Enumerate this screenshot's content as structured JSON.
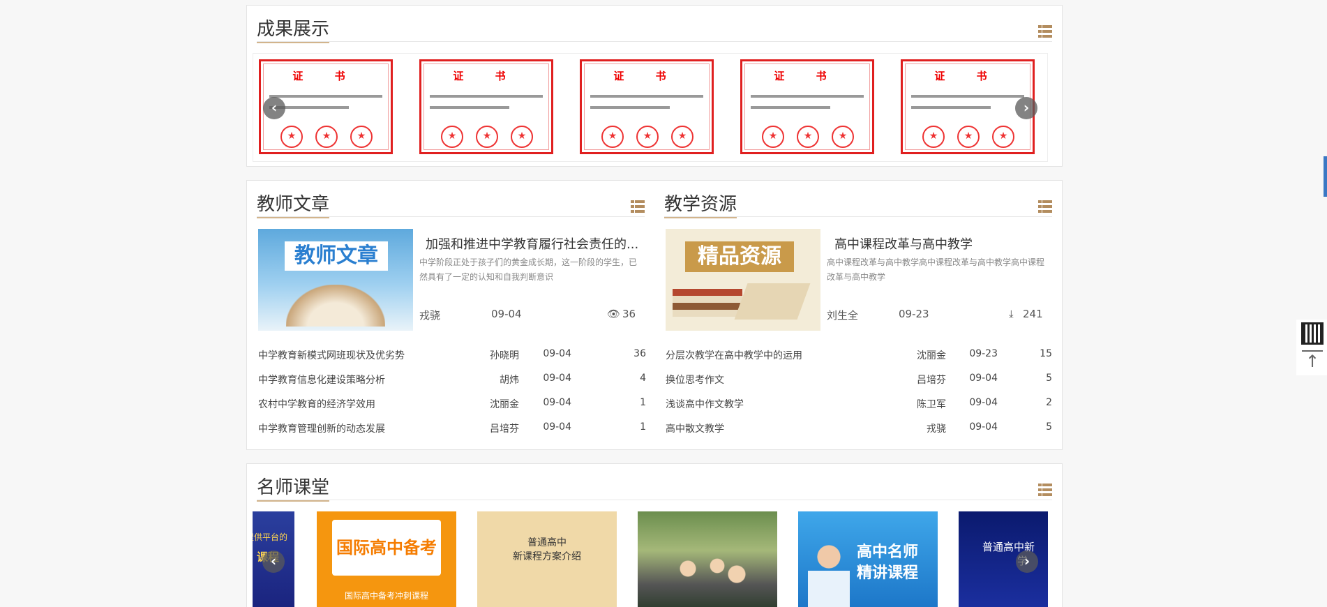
{
  "achievements": {
    "title": "成果展示",
    "cert_title": "证 书",
    "items": [
      "cert-1",
      "cert-2",
      "cert-3",
      "cert-4",
      "cert-5"
    ],
    "prev_icon": "chevron-left-icon",
    "next_icon": "chevron-right-icon"
  },
  "articles": {
    "title": "教师文章",
    "featured": {
      "image_text": "教师文章",
      "title": "加强和推进中学教育履行社会责任的...",
      "desc": "中学阶段正处于孩子们的黄金成长期，这一阶段的学生，已然具有了一定的认知和自我判断意识",
      "author": "戎骁",
      "date": "09-04",
      "views": "36"
    },
    "list": [
      {
        "title": "中学教育新模式网班现状及优劣势",
        "author": "孙晓明",
        "date": "09-04",
        "count": "36"
      },
      {
        "title": "中学教育信息化建设策略分析",
        "author": "胡炜",
        "date": "09-04",
        "count": "4"
      },
      {
        "title": "农村中学教育的经济学效用",
        "author": "沈丽金",
        "date": "09-04",
        "count": "1"
      },
      {
        "title": "中学教育管理创新的动态发展",
        "author": "吕培芬",
        "date": "09-04",
        "count": "1"
      }
    ]
  },
  "resources": {
    "title": "教学资源",
    "featured": {
      "image_text": "精品资源",
      "title": "高中课程改革与高中教学",
      "desc": "高中课程改革与高中教学高中课程改革与高中教学高中课程改革与高中教学",
      "author": "刘生全",
      "date": "09-23",
      "downloads": "241"
    },
    "list": [
      {
        "title": "分层次教学在高中教学中的运用",
        "author": "沈丽金",
        "date": "09-23",
        "count": "15"
      },
      {
        "title": "换位思考作文",
        "author": "吕培芬",
        "date": "09-04",
        "count": "5"
      },
      {
        "title": "浅谈高中作文教学",
        "author": "陈卫军",
        "date": "09-04",
        "count": "2"
      },
      {
        "title": "高中散文教学",
        "author": "戎骁",
        "date": "09-04",
        "count": "5"
      }
    ]
  },
  "lessons": {
    "title": "名师课堂",
    "items": [
      {
        "line1": "提供平台的",
        "line2": "课程"
      },
      {
        "line1": "国际高中备考",
        "line2": "国际高中备考冲刺课程"
      },
      {
        "line1": "普通高中",
        "line2": "新课程方案介绍"
      },
      {
        "line1": "",
        "line2": ""
      },
      {
        "line1": "高中名师",
        "line2": "精讲课程"
      },
      {
        "line1": "普通高中新",
        "line2": "学"
      }
    ]
  },
  "side": {
    "qr_icon": "qr-code-icon",
    "top_icon": "back-to-top-icon"
  },
  "colors": {
    "accent": "#b38d5f",
    "cert_red": "#e02020"
  }
}
